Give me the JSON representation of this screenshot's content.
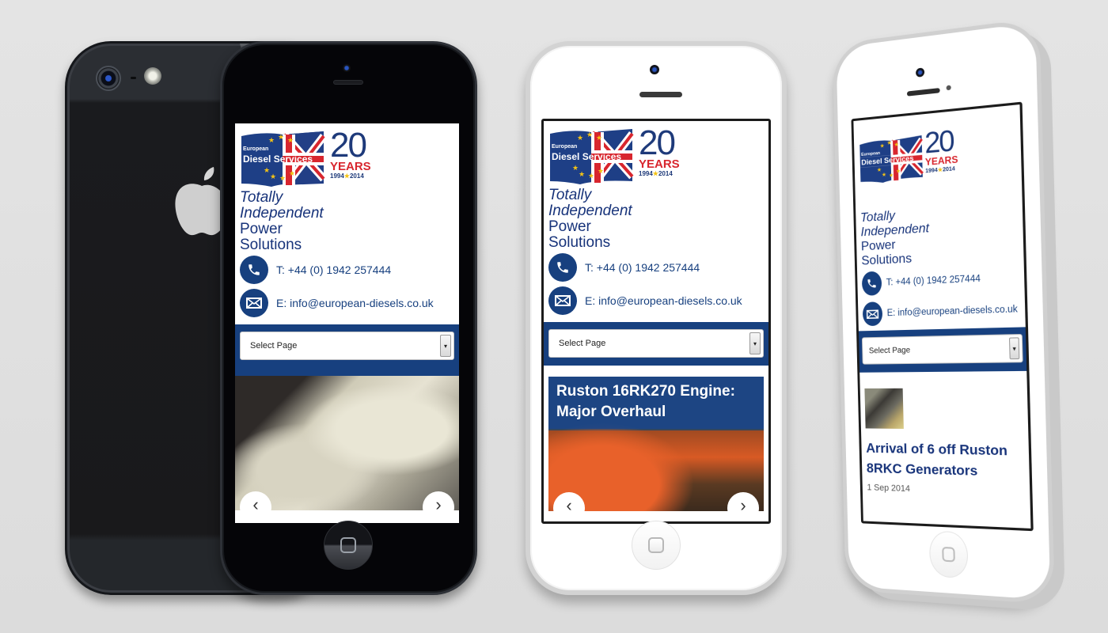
{
  "brand": {
    "name_line1": "European",
    "name_line2": "Diesel Services",
    "anniversary_number": "20",
    "anniversary_word": "YEARS",
    "year_start": "1994",
    "year_end": "2014",
    "colors": {
      "navy": "#17407f",
      "red": "#d8262e",
      "gold": "#f4c316"
    }
  },
  "tagline": {
    "line1": "Totally",
    "line2": "Independent",
    "line3": "Power",
    "line4": "Solutions"
  },
  "contact": {
    "phone_icon": "phone-icon",
    "phone": "T: +44 (0) 1942 257444",
    "email_icon": "envelope-icon",
    "email": "E: info@european-diesels.co.uk"
  },
  "nav": {
    "select_value": "Select Page",
    "arrow_icon": "▾"
  },
  "devices": {
    "black_phone": {
      "slider": {
        "caption": "",
        "prev_icon": "‹",
        "next_icon": "›"
      }
    },
    "white_phone_middle": {
      "slider": {
        "caption_line1": "Ruston 16RK270 Engine:",
        "caption_line2": "Major Overhaul",
        "prev_icon": "‹",
        "next_icon": "›"
      }
    },
    "white_phone_right": {
      "news": {
        "title_line1": "Arrival of 6 off Ruston",
        "title_line2": "8RKC Generators",
        "date": "1 Sep 2014"
      }
    }
  }
}
